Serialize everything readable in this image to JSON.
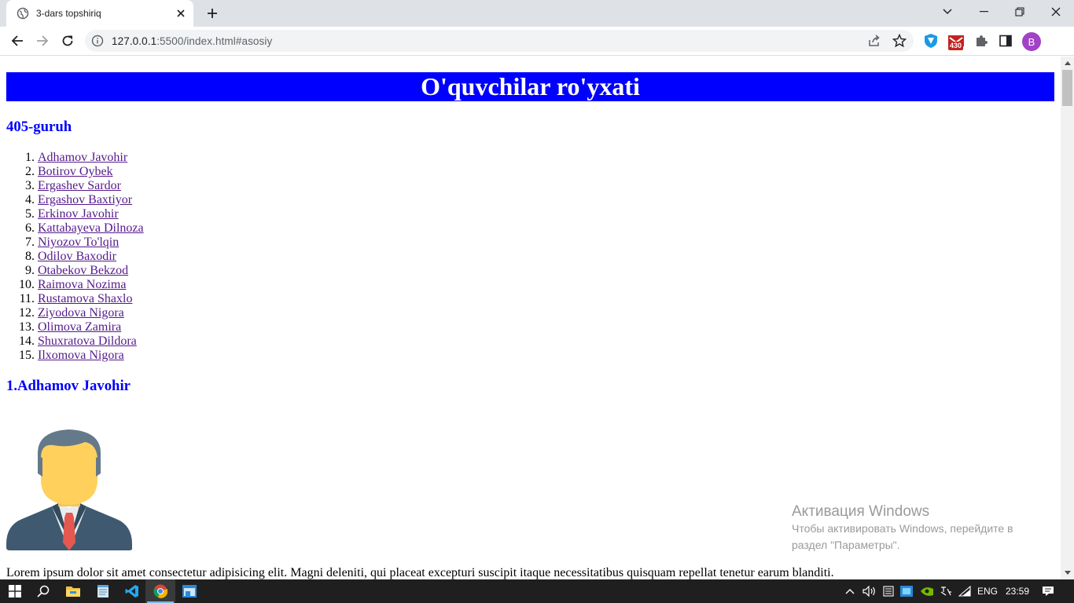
{
  "browser": {
    "tab_title": "3-dars topshiriq",
    "url_host": "127.0.0.1",
    "url_path": ":5500/index.html#asosiy",
    "extension_badge": "430",
    "profile_initial": "B"
  },
  "page": {
    "title": "O'quvchilar ro'yxati",
    "group_heading": "405-guruh",
    "students": [
      "Adhamov Javohir",
      "Botirov Oybek",
      "Ergashev Sardor",
      "Ergashov Baxtiyor",
      "Erkinov Javohir",
      "Kattabayeva Dilnoza",
      "Niyozov To'lqin",
      "Odilov Baxodir",
      "Otabekov Bekzod",
      "Raimova Nozima",
      "Rustamova Shaxlo",
      "Ziyodova Nigora",
      "Olimova Zamira",
      "Shuxratova Dildora",
      "Ilxomova Nigora"
    ],
    "student_heading": "1.Adhamov Javohir",
    "lorem": "Lorem ipsum dolor sit amet consectetur adipisicing elit. Magni deleniti, qui placeat excepturi suscipit itaque necessitatibus quisquam repellat tenetur earum blanditi."
  },
  "activation": {
    "title": "Активация Windows",
    "line1": "Чтобы активировать Windows, перейдите в",
    "line2": "раздел \"Параметры\"."
  },
  "taskbar": {
    "language": "ENG",
    "time": "23:59"
  },
  "colors": {
    "title_bg": "#0000ff",
    "heading": "#0000ff",
    "link_visited": "#551a8b"
  }
}
